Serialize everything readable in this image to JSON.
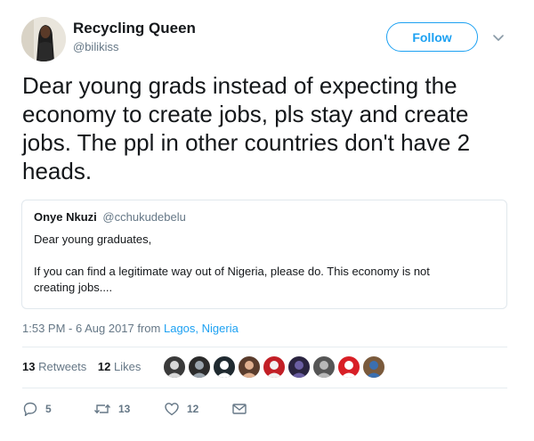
{
  "author": {
    "name": "Recycling Queen",
    "handle": "@bilikiss"
  },
  "follow_label": "Follow",
  "tweet_text": "Dear young grads instead of expecting the\neconomy to create jobs, pls stay and create\njobs. The ppl in other countries don't have 2\nheads.",
  "quoted": {
    "name": "Onye Nkuzi",
    "handle": "@cchukudebelu",
    "text": "Dear young graduates,\n\nIf you can find a legitimate way out of Nigeria, please do. This economy is not\ncreating jobs...."
  },
  "meta": {
    "time": "1:53 PM - 6 Aug 2017 from ",
    "location": "Lagos, Nigeria"
  },
  "stats": {
    "retweets_count": "13",
    "retweets_label": "Retweets",
    "likes_count": "12",
    "likes_label": "Likes"
  },
  "liker_avatars": [
    {
      "bg": "#3a3a3a",
      "fg": "#d8d8d8"
    },
    {
      "bg": "#2b2b2b",
      "fg": "#9aa4ad"
    },
    {
      "bg": "#1f2a30",
      "fg": "#ffffff"
    },
    {
      "bg": "#5a3c2c",
      "fg": "#e0b090"
    },
    {
      "bg": "#c21f26",
      "fg": "#f2f2f2"
    },
    {
      "bg": "#2a2440",
      "fg": "#6b5fa3"
    },
    {
      "bg": "#555555",
      "fg": "#b8b8b8"
    },
    {
      "bg": "#d81f26",
      "fg": "#ffffff"
    },
    {
      "bg": "#7a5a3c",
      "fg": "#3b6fb0"
    }
  ],
  "actions": {
    "replies": "5",
    "retweets": "13",
    "likes": "12"
  },
  "icons": {
    "caret": "chevron-down-icon",
    "reply": "reply-icon",
    "retweet": "retweet-icon",
    "like": "heart-icon",
    "message": "envelope-icon"
  },
  "colors": {
    "accent": "#1da1f2",
    "muted": "#657786",
    "text": "#14171a",
    "border": "#e1e8ed"
  }
}
